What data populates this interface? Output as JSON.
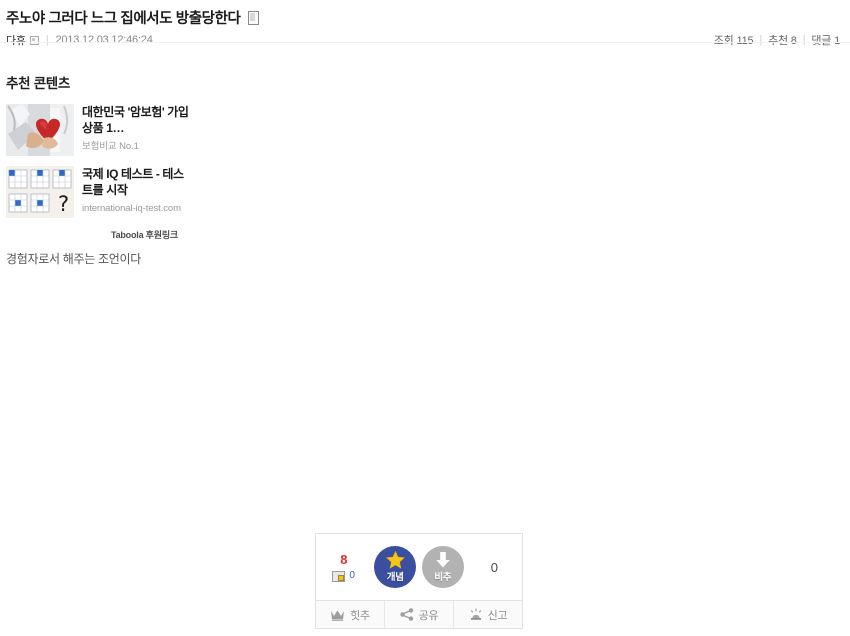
{
  "post": {
    "title": "주노야 그러다 느그 집에서도 방출당한다",
    "title_trailing_icon": "broken-image-icon",
    "author": "다휴",
    "author_trailing_icon": "broken-image-icon",
    "date": "2013.12.03 12:46:24",
    "separator": "|",
    "stats": {
      "views": "조회 115",
      "recommends": "추천 8",
      "comments": "댓글 1"
    },
    "body": "경험자로서 해주는 조언이다"
  },
  "recommended": {
    "heading": "추천 콘텐츠",
    "credit": "Taboola 후원링크",
    "items": [
      {
        "thumb_icon": "heart-in-hand-photo",
        "title": "대한민국 '암보험' 가입상품 1…",
        "subtitle": "보험비교 No.1"
      },
      {
        "thumb_icon": "iq-matrix-puzzle-image",
        "title": "국제 IQ 테스트 - 테스트를 시작",
        "subtitle": "international-iq-test.com"
      }
    ]
  },
  "vote_widget": {
    "up_count": "8",
    "image_count": "0",
    "image_count_icon": "image-thumbnail-icon",
    "down_count": "0",
    "up_button": {
      "label": "개념",
      "icon": "star-icon",
      "color": "#3b4fa0",
      "icon_color": "#f5c518"
    },
    "down_button": {
      "label": "비추",
      "icon": "arrow-down-icon",
      "color": "#b2b2b2",
      "icon_color": "#ffffff"
    },
    "actions": [
      {
        "label": "힛추",
        "icon": "crown-icon"
      },
      {
        "label": "공유",
        "icon": "share-icon"
      },
      {
        "label": "신고",
        "icon": "siren-icon"
      }
    ]
  },
  "colors": {
    "up_count": "#d9342b",
    "image_count": "#3a66c4",
    "divider": "#f2f2f2",
    "widget_border": "#e2e2e2"
  }
}
